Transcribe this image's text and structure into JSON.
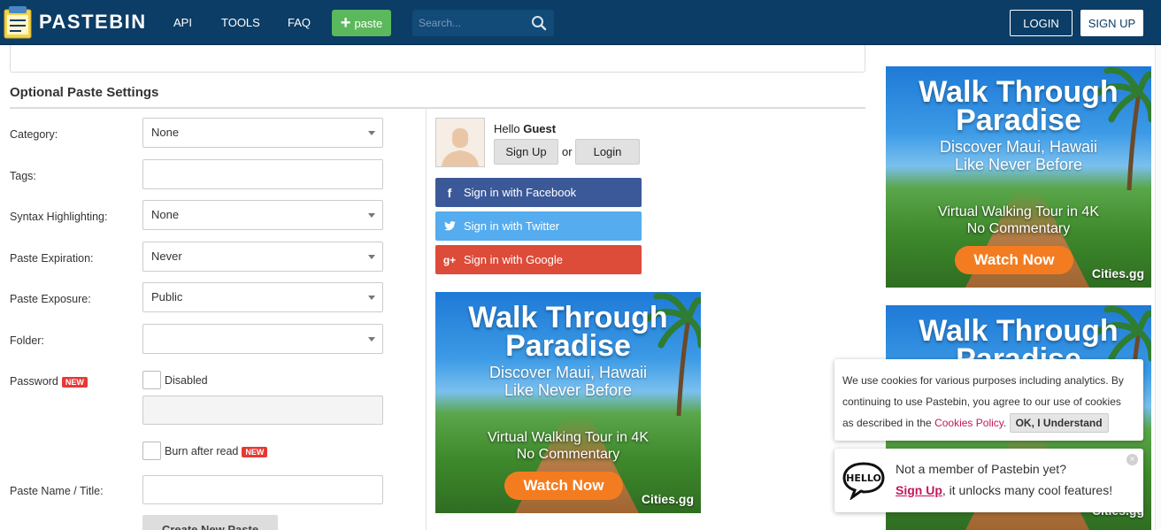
{
  "header": {
    "logo_text": "PASTEBIN",
    "nav": [
      {
        "label": "API"
      },
      {
        "label": "TOOLS"
      },
      {
        "label": "FAQ"
      }
    ],
    "paste_label": "paste",
    "search_placeholder": "Search...",
    "login_label": "LOGIN",
    "signup_label": "SIGN UP"
  },
  "settings": {
    "title": "Optional Paste Settings",
    "category": {
      "label": "Category:",
      "value": "None"
    },
    "tags": {
      "label": "Tags:",
      "value": ""
    },
    "syntax": {
      "label": "Syntax Highlighting:",
      "value": "None"
    },
    "expiration": {
      "label": "Paste Expiration:",
      "value": "Never"
    },
    "exposure": {
      "label": "Paste Exposure:",
      "value": "Public"
    },
    "folder": {
      "label": "Folder:",
      "value": ""
    },
    "password": {
      "label": "Password",
      "badge": "NEW",
      "checkbox_label": "Disabled"
    },
    "burn": {
      "checkbox_label": "Burn after read",
      "badge": "NEW"
    },
    "name": {
      "label": "Paste Name / Title:",
      "value": ""
    },
    "create_label": "Create New Paste"
  },
  "user": {
    "hello": "Hello",
    "name": "Guest",
    "signup_label": "Sign Up",
    "or": "or",
    "login_label": "Login",
    "facebook": "Sign in with Facebook",
    "twitter": "Sign in with Twitter",
    "google": "Sign in with Google"
  },
  "ad": {
    "title_1": "Walk Through",
    "title_2": "Paradise",
    "sub_1": "Discover Maui, Hawaii",
    "sub_2": "Like Never Before",
    "tour_1": "Virtual Walking Tour in 4K",
    "tour_2": "No Commentary",
    "cta": "Watch Now",
    "brand": "Cities.gg"
  },
  "cookie": {
    "text": "We use cookies for various purposes including analytics. By continuing to use Pastebin, you agree to our use of cookies as described in the",
    "link": "Cookies Policy",
    "button": "OK, I Understand"
  },
  "member": {
    "line_1": "Not a member of Pastebin yet?",
    "signup": "Sign Up",
    "line_2_rest": ", it unlocks many cool features!"
  },
  "colors": {
    "header_bg": "#0b3d66",
    "paste_green": "#5cb85c",
    "facebook": "#3b5998",
    "twitter": "#55acee",
    "google": "#dd4b39",
    "new_badge": "#e53935",
    "cta_orange": "#f47c20",
    "link_pink": "#c2185b"
  }
}
